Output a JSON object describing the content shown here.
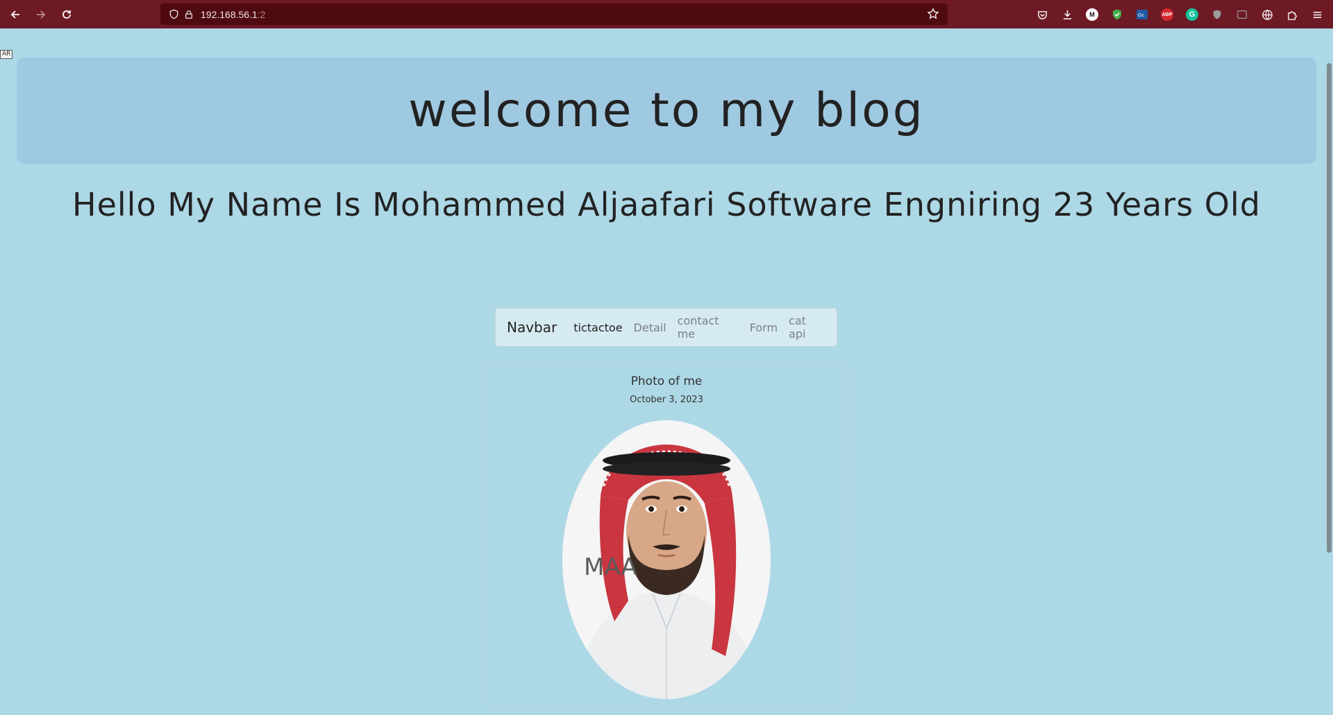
{
  "browser": {
    "url_host": "192.168.56.1",
    "url_suffix": ":2",
    "extensions": [
      "pocket-icon",
      "download-icon",
      "m-icon",
      "shield-green-icon",
      "translate-icon",
      "adblock-icon",
      "grammarly-icon",
      "shield-gray-icon",
      "window-icon",
      "globe-icon",
      "puzzle-icon",
      "menu-icon"
    ],
    "adblock_label": "ABP",
    "m_label": "M"
  },
  "page": {
    "ar_mark": "AR",
    "jumbotron_title": "welcome to my blog",
    "intro": "Hello My Name Is Mohammed Aljaafari Software Engniring 23 Years Old",
    "navbar": {
      "brand": "Navbar",
      "links": [
        "tictactoe",
        "Detail",
        "contact me",
        "Form",
        "cat api"
      ],
      "active_index": 0
    },
    "post": {
      "title": "Photo of me",
      "date": "October 3, 2023",
      "image_overlay_text": "MAA"
    }
  },
  "colors": {
    "chrome": "#6e1a24",
    "urlbar": "#4f0a10",
    "page_bg": "#add8e6",
    "jumbotron_bg": "#9fc9e1"
  }
}
